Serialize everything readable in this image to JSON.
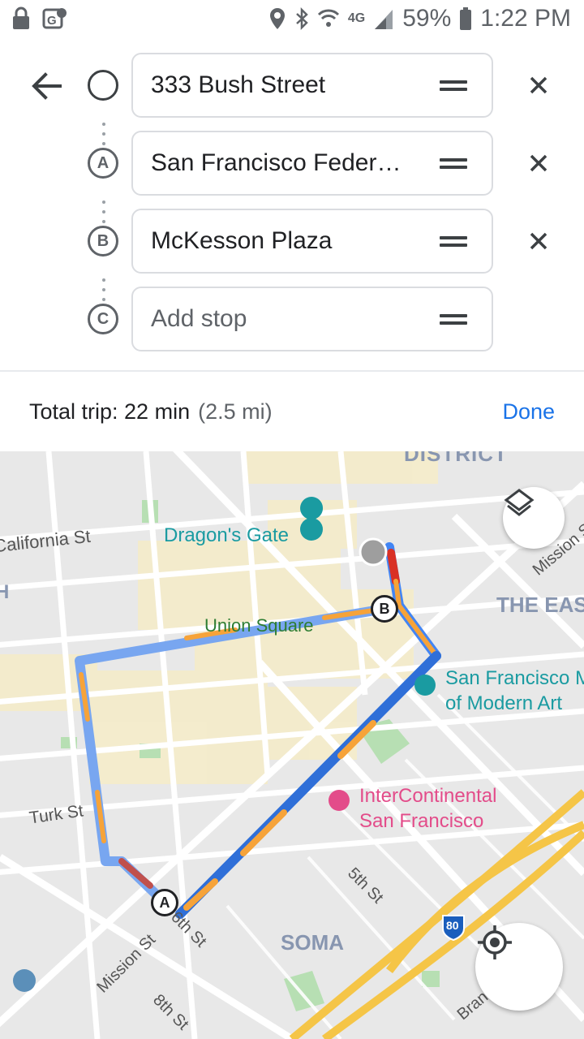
{
  "status_bar": {
    "battery": "59%",
    "time": "1:22 PM",
    "network": "4G"
  },
  "directions": {
    "stops": [
      {
        "marker": "",
        "value": "333 Bush Street",
        "removable": true
      },
      {
        "marker": "A",
        "value": "San Francisco Feder…",
        "removable": true
      },
      {
        "marker": "B",
        "value": "McKesson Plaza",
        "removable": true
      },
      {
        "marker": "C",
        "value": "",
        "placeholder": "Add stop",
        "removable": false
      }
    ],
    "trip_label": "Total trip: 22 min",
    "trip_distance": "(2.5 mi)",
    "done_label": "Done"
  },
  "map": {
    "labels": {
      "district": "DISTRICT",
      "california_st": "California St",
      "dragons_gate": "Dragon's Gate",
      "mission_st_ne": "Mission S",
      "the_east": "THE EAS",
      "union_square": "Union Square",
      "sfmoma_1": "San Francisco M",
      "sfmoma_2": "of Modern Art",
      "intercontinental_1": "InterContinental",
      "intercontinental_2": "San Francisco",
      "turk_st": "Turk St",
      "fifth_st": "5th St",
      "sixth_st": "6th St",
      "soma": "SOMA",
      "mission_st": "Mission St",
      "eighth_st": "8th St",
      "highway": "80",
      "brannan": "Bran",
      "h_label": "H"
    },
    "route_markers": [
      "A",
      "B"
    ],
    "colors": {
      "route_blue": "#4285f4",
      "route_orange": "#f6a339",
      "route_red": "#d93025",
      "poi_teal": "#1a9ba1",
      "poi_pink": "#e34c8a",
      "park_green": "#34a853"
    }
  }
}
